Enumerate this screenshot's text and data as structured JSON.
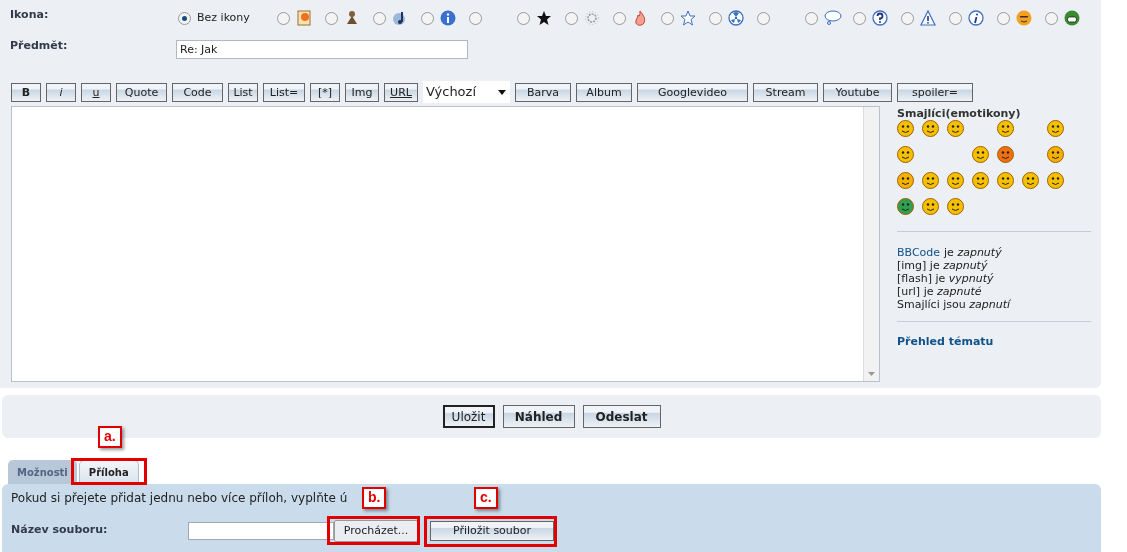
{
  "icon_field": {
    "label": "Ikona:",
    "options": [
      {
        "kind": "none",
        "label": "Bez ikony",
        "selected": true
      },
      {
        "kind": "note",
        "selected": false
      },
      {
        "kind": "figure",
        "selected": false
      },
      {
        "kind": "music",
        "selected": false
      },
      {
        "kind": "info",
        "selected": false
      },
      {
        "kind": "empty",
        "selected": false
      },
      {
        "kind": "star",
        "selected": false
      },
      {
        "kind": "sun",
        "selected": false
      },
      {
        "kind": "fire",
        "selected": false
      },
      {
        "kind": "star-outline",
        "selected": false
      },
      {
        "kind": "radiation",
        "selected": false
      },
      {
        "kind": "empty",
        "selected": false
      },
      {
        "kind": "speech",
        "selected": false
      },
      {
        "kind": "question",
        "selected": false
      },
      {
        "kind": "warning",
        "selected": false
      },
      {
        "kind": "info-italic",
        "selected": false
      },
      {
        "kind": "smiley",
        "selected": false
      },
      {
        "kind": "grin",
        "selected": false
      }
    ]
  },
  "subject": {
    "label": "Předmět:",
    "value": "Re: Jak"
  },
  "toolbar": [
    {
      "kind": "bold",
      "label": "B"
    },
    {
      "kind": "italic",
      "label": "i"
    },
    {
      "kind": "underline",
      "label": "u"
    },
    {
      "kind": "button",
      "label": "Quote"
    },
    {
      "kind": "button",
      "label": "Code"
    },
    {
      "kind": "button",
      "label": "List"
    },
    {
      "kind": "button",
      "label": "List="
    },
    {
      "kind": "button",
      "label": "[*]"
    },
    {
      "kind": "button",
      "label": "Img"
    },
    {
      "kind": "underline",
      "label": "URL"
    },
    {
      "kind": "select",
      "label": "Výchozí"
    },
    {
      "kind": "button",
      "label": "Barva"
    },
    {
      "kind": "button",
      "label": "Album"
    },
    {
      "kind": "button",
      "label": "Googlevideo"
    },
    {
      "kind": "button",
      "label": "Stream"
    },
    {
      "kind": "button",
      "label": "Youtube"
    },
    {
      "kind": "button",
      "label": "spoiler="
    }
  ],
  "sidebar": {
    "smileys_title": "Smajlíci(emotikony)",
    "status_lines": [
      {
        "link": "BBCode",
        "text": "je *zapnutý*"
      },
      {
        "text": "[img] je *zapnutý*"
      },
      {
        "text": "[flash] je *vypnutý*"
      },
      {
        "text": "[url] je *zapnuté*"
      },
      {
        "text": "Smajlíci jsou *zapnutí*"
      }
    ],
    "topic_link": "Přehled tématu"
  },
  "actions": [
    {
      "label": "Uložit",
      "default": true
    },
    {
      "label": "Náhled",
      "default": false
    },
    {
      "label": "Odeslat",
      "default": false
    }
  ],
  "tabs": [
    {
      "label": "Možnosti",
      "selected": false
    },
    {
      "label": "Příloha",
      "selected": true
    }
  ],
  "attachment": {
    "hint": "Pokud si přejete přidat jednu nebo více příloh, vyplňte ú",
    "file_label": "Název souboru:",
    "browse": "Procházet...",
    "attach": "Přiložit soubor"
  },
  "callouts": [
    "a.",
    "b.",
    "c."
  ]
}
